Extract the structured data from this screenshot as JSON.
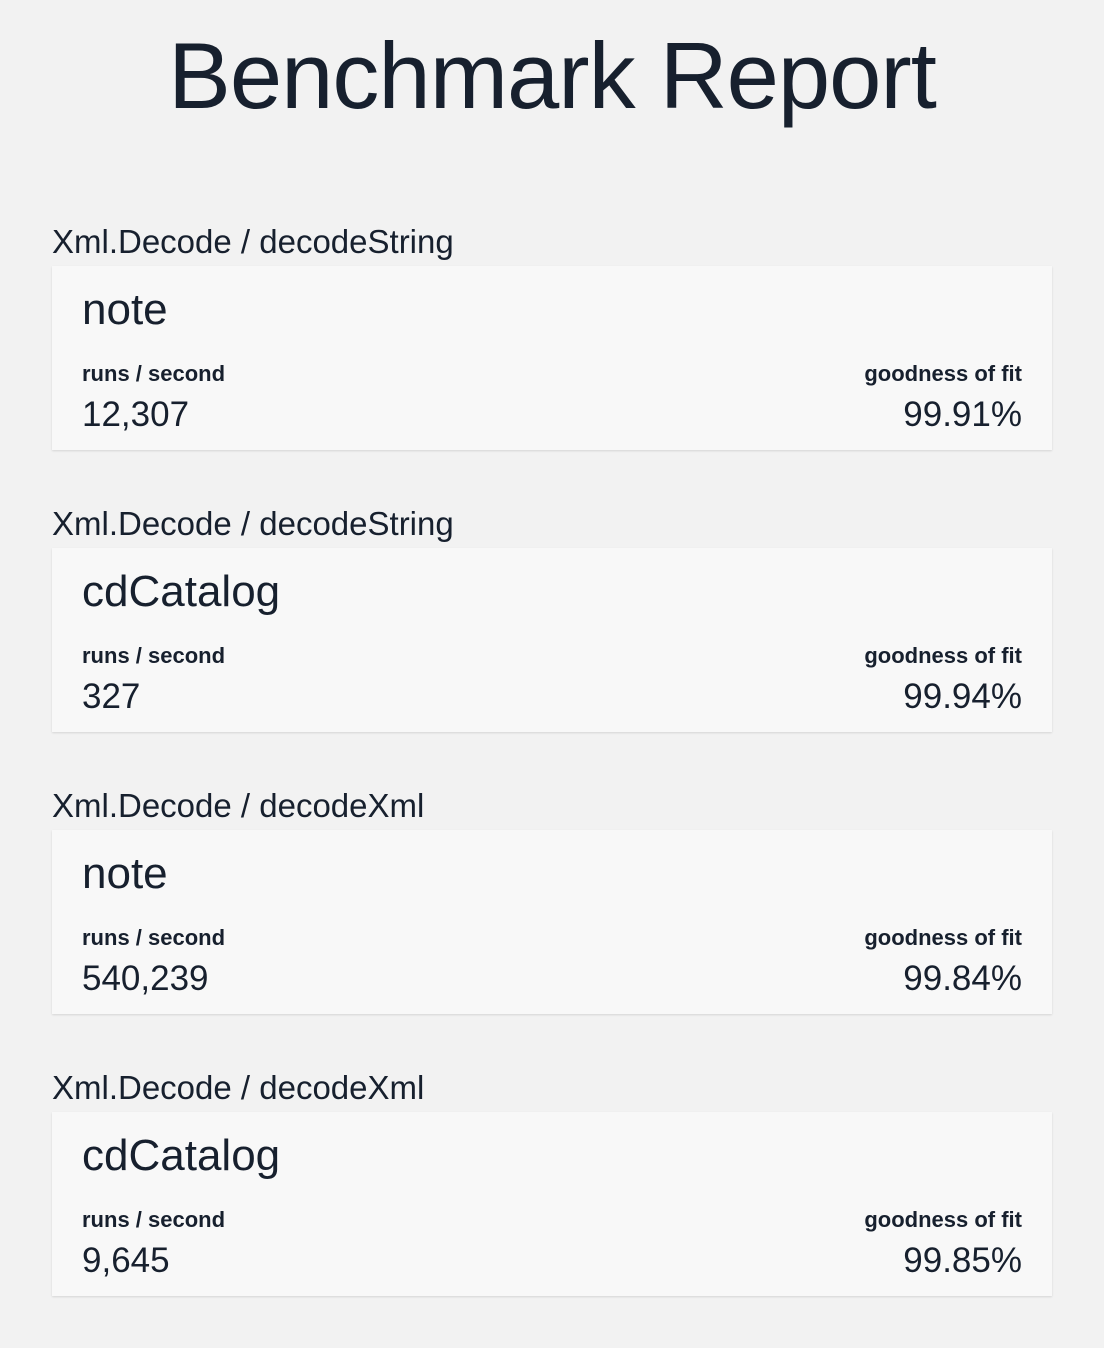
{
  "title": "Benchmark Report",
  "groups": [
    {
      "label": "Xml.Decode / decodeString",
      "name": "note",
      "runs_label": "runs / second",
      "runs_value": "12,307",
      "fit_label": "goodness of fit",
      "fit_value": "99.91%"
    },
    {
      "label": "Xml.Decode / decodeString",
      "name": "cdCatalog",
      "runs_label": "runs / second",
      "runs_value": "327",
      "fit_label": "goodness of fit",
      "fit_value": "99.94%"
    },
    {
      "label": "Xml.Decode / decodeXml",
      "name": "note",
      "runs_label": "runs / second",
      "runs_value": "540,239",
      "fit_label": "goodness of fit",
      "fit_value": "99.84%"
    },
    {
      "label": "Xml.Decode / decodeXml",
      "name": "cdCatalog",
      "runs_label": "runs / second",
      "runs_value": "9,645",
      "fit_label": "goodness of fit",
      "fit_value": "99.85%"
    }
  ]
}
